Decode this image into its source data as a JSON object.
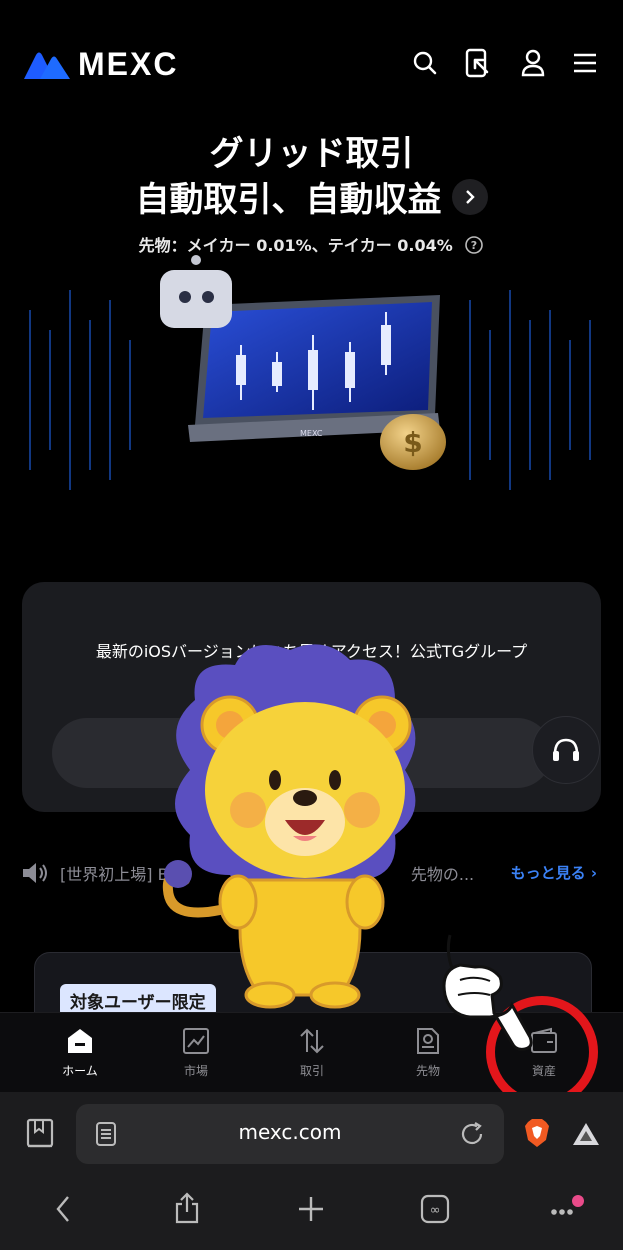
{
  "header": {
    "logo_text": "MEXC",
    "icons": [
      "search-icon",
      "download-app-icon",
      "user-icon",
      "menu-icon"
    ]
  },
  "hero": {
    "title_line1": "グリッド取引",
    "title_line2": "自動取引、自動収益",
    "fee_text": "先物：メイカー 0.01%、テイカー 0.04%",
    "laptop_brand": "MEXC"
  },
  "card": {
    "message": "最新のiOSバージョンにいち早くアクセス！公式TGグループ"
  },
  "notice": {
    "text": "[世界初上場] BO",
    "text_tail": "先物の...",
    "more_label": "もっと見る"
  },
  "promo": {
    "badge": "対象ユーザー限定"
  },
  "tabs": [
    {
      "label": "ホーム",
      "icon": "home-icon"
    },
    {
      "label": "市場",
      "icon": "chart-icon"
    },
    {
      "label": "取引",
      "icon": "trade-arrows-icon"
    },
    {
      "label": "先物",
      "icon": "futures-icon"
    },
    {
      "label": "資産",
      "icon": "wallet-icon"
    }
  ],
  "browser": {
    "url": "mexc.com"
  },
  "colors": {
    "accent_blue": "#3b82f6",
    "highlight_red": "#e3161b"
  }
}
